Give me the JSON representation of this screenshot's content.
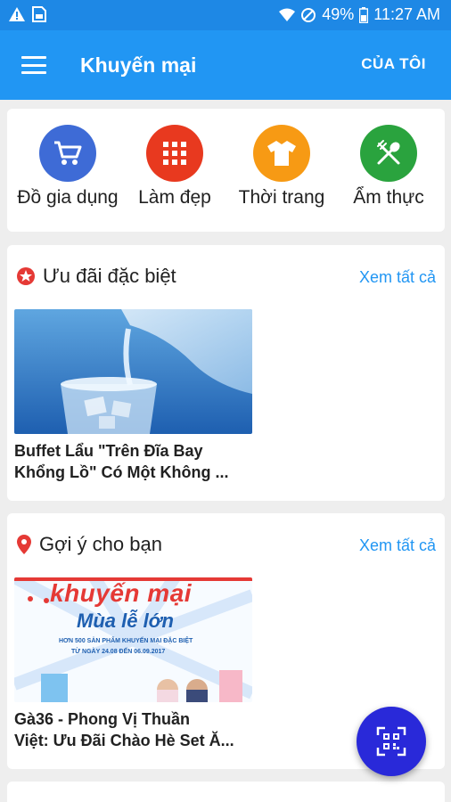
{
  "status_bar": {
    "battery_pct": "49%",
    "time": "11:27 AM",
    "icons": [
      "warning-icon",
      "sim-icon",
      "wifi-icon",
      "dnd-icon",
      "battery-icon"
    ]
  },
  "app_bar": {
    "title": "Khuyến mại",
    "action": "CỦA TÔI"
  },
  "categories": [
    {
      "label": "Đồ gia dụng",
      "icon": "cart-icon",
      "color": "#3E6BD6"
    },
    {
      "label": "Làm đẹp",
      "icon": "grid-icon",
      "color": "#E8391F"
    },
    {
      "label": "Thời trang",
      "icon": "shirt-icon",
      "color": "#F79A14"
    },
    {
      "label": "Ẩm thực",
      "icon": "fork-spoon-icon",
      "color": "#2AA33E"
    }
  ],
  "special": {
    "title": "Ưu đãi đặc biệt",
    "see_all": "Xem tất cả",
    "item": {
      "title_line1": "Buffet Lẩu \"Trên Đĩa Bay",
      "title_line2": "Khổng Lồ\" Có Một Không ..."
    }
  },
  "suggest": {
    "title": "Gợi ý cho bạn",
    "see_all": "Xem tất cả",
    "banner": {
      "brand": "khuyến mại",
      "headline": "Mùa lễ lớn",
      "subline": "HƠN 500 SẢN PHẨM KHUYẾN MẠI ĐẶC BIỆT",
      "dates": "TỪ NGÀY 24.08 ĐẾN 06.09.2017"
    },
    "item": {
      "title_line1": "Gà36 - Phong Vị Thuần",
      "title_line2": "Việt: Ưu Đãi Chào Hè Set Ă..."
    }
  },
  "colors": {
    "primary": "#2196F3",
    "status_bar": "#1E88E5",
    "fab": "#2929D9",
    "accent_red": "#E53935"
  }
}
